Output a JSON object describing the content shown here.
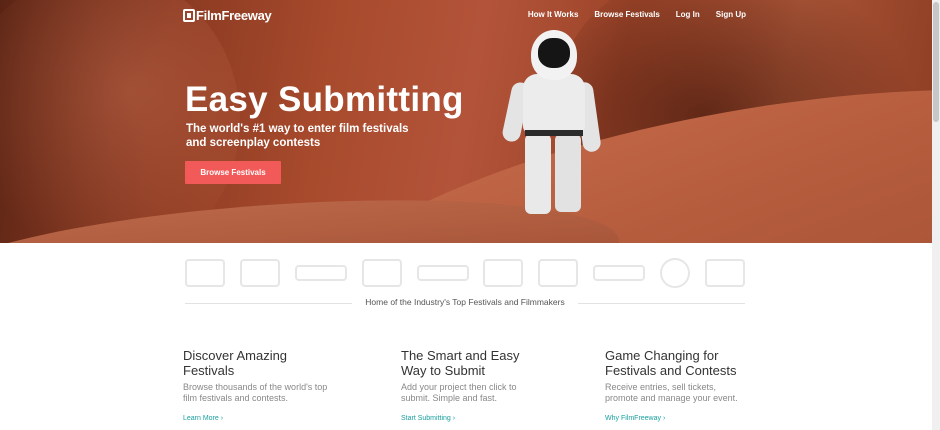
{
  "brand": {
    "name": "FilmFreeway"
  },
  "nav": {
    "items": [
      "How It Works",
      "Browse Festivals",
      "Log In",
      "Sign Up"
    ]
  },
  "hero": {
    "title": "Easy Submitting",
    "subtitle_line1": "The world's #1 way to enter film festivals",
    "subtitle_line2": "and screenplay contests",
    "button_label": "Browse Festivals"
  },
  "logos_caption": "Home of the Industry's Top Festivals and Filmmakers",
  "features": [
    {
      "title_line1": "Discover Amazing",
      "title_line2": "Festivals",
      "desc_line1": "Browse thousands of the world's top",
      "desc_line2": "film festivals and contests.",
      "link": "Learn More ›"
    },
    {
      "title_line1": "The Smart and Easy",
      "title_line2": "Way to Submit",
      "desc_line1": "Add your project then click to",
      "desc_line2": "submit. Simple and fast.",
      "link": "Start Submitting ›"
    },
    {
      "title_line1": "Game Changing for",
      "title_line2": "Festivals and Contests",
      "desc_line1": "Receive entries, sell tickets,",
      "desc_line2": "promote and manage your event.",
      "link": "Why FilmFreeway ›"
    }
  ],
  "colors": {
    "accent": "#f25a5a",
    "link": "#1aa0a0"
  }
}
